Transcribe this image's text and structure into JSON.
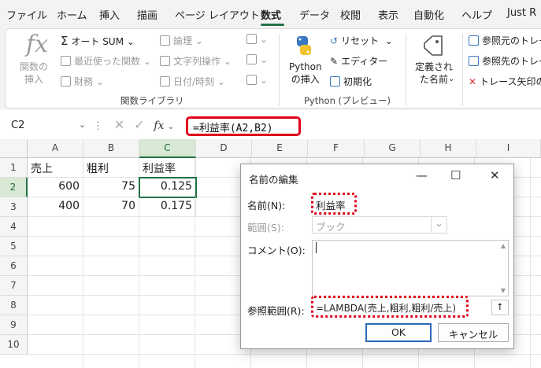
{
  "menu": {
    "tabs": [
      "ファイル",
      "ホーム",
      "挿入",
      "描画",
      "ページ レイアウト",
      "数式",
      "データ",
      "校閲",
      "表示",
      "自動化",
      "ヘルプ",
      "Just R"
    ],
    "active_index": 5
  },
  "ribbon": {
    "fx_symbol": "fx",
    "insert_function": "関数の\n挿入",
    "autosum": "オート SUM",
    "recent": "最近使った関数",
    "financial": "財務",
    "logical": "論理",
    "text": "文字列操作",
    "datetime": "日付/時刻",
    "group_library": "関数ライブラリ",
    "python_insert": "Python\nの挿入",
    "reset": "リセット",
    "editor": "エディター",
    "initialize": "初期化",
    "group_python": "Python (プレビュー)",
    "defined_names": "定義され\nた名前",
    "trace_precedents": "参照元のトレー",
    "trace_dependents": "参照先のトレー",
    "remove_arrows": "トレース矢印の"
  },
  "formula_bar": {
    "name_box": "C2",
    "fx": "fx",
    "formula": "=利益率(A2,B2)"
  },
  "sheet": {
    "columns": [
      "A",
      "B",
      "C",
      "D",
      "E",
      "F",
      "G",
      "H",
      "I"
    ],
    "rows": [
      "1",
      "2",
      "3",
      "4",
      "5",
      "6",
      "7",
      "8",
      "9",
      "10"
    ],
    "cells": {
      "A1": "売上",
      "B1": "粗利",
      "C1": "利益率",
      "A2": "600",
      "B2": "75",
      "C2": "0.125",
      "A3": "400",
      "B3": "70",
      "C3": "0.175"
    }
  },
  "dialog": {
    "title": "名前の編集",
    "name_label": "名前(N):",
    "name_value": "利益率",
    "scope_label": "範囲(S):",
    "scope_value": "ブック",
    "comment_label": "コメント(O):",
    "comment_value": "",
    "refers_label": "参照範囲(R):",
    "refers_value": "=LAMBDA(売上,粗利,粗利/売上)",
    "ok": "OK",
    "cancel": "キャンセル"
  },
  "colors": {
    "accent_green": "#217346",
    "highlight_red": "#e0001a"
  }
}
